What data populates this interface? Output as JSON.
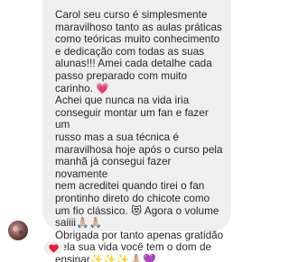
{
  "message": {
    "text": "Carol seu curso é simplesmente\nmaravilhoso tanto as aulas práticas\ncomo teóricas muito conhecimento\ne dedicação com todas as suas\nalunas!!! Amei cada detalhe cada\npasso preparado com muito\ncarinho. 💗\nAchei que nunca na vida iria\nconseguir montar um fan e fazer um\nrusso mas a sua técnica é\nmaravilhosa hoje após o curso pela\nmanhã já consegui fazer novamente\nnem acreditei quando tirei o fan\nprontinho direto do chicote como\num fio clássico. 😻 Agora o volume\nsaiiii🙏🏼🙏🏼\nObrigada por tanto apenas gratidão\npela sua vida você tem o dom de\nensinar✨✨✨🙏🏼💜"
  },
  "reaction": {
    "emoji": "❤️"
  },
  "sender": {
    "avatar_icon": "user-avatar"
  }
}
